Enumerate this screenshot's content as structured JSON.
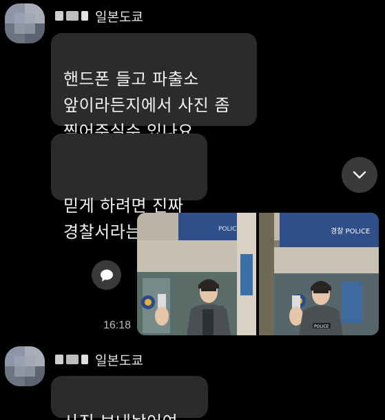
{
  "messages": {
    "group1": {
      "sender_name": "일본도쿄",
      "bubble1": "핸드폰 들고 파출소\n앞이라든지에서 사진 좀\n찍어주실수 있나요",
      "bubble2": "믿게 하려면 진짜\n경찰서라는걸"
    },
    "sent_photos": {
      "time": "16:18",
      "sign_text": "경찰 POLICE",
      "vest_text": "POLICE"
    },
    "group2": {
      "sender_name": "일본도쿄",
      "bubble1": "사진 보내놨어여~"
    }
  },
  "icons": {
    "scroll_down": "chevron-down-icon",
    "comment": "speech-bubble-icon"
  },
  "colors": {
    "background": "#000000",
    "bubble": "#2b2b2b",
    "text": "#f2f2f2",
    "time": "#bdbdbd"
  }
}
